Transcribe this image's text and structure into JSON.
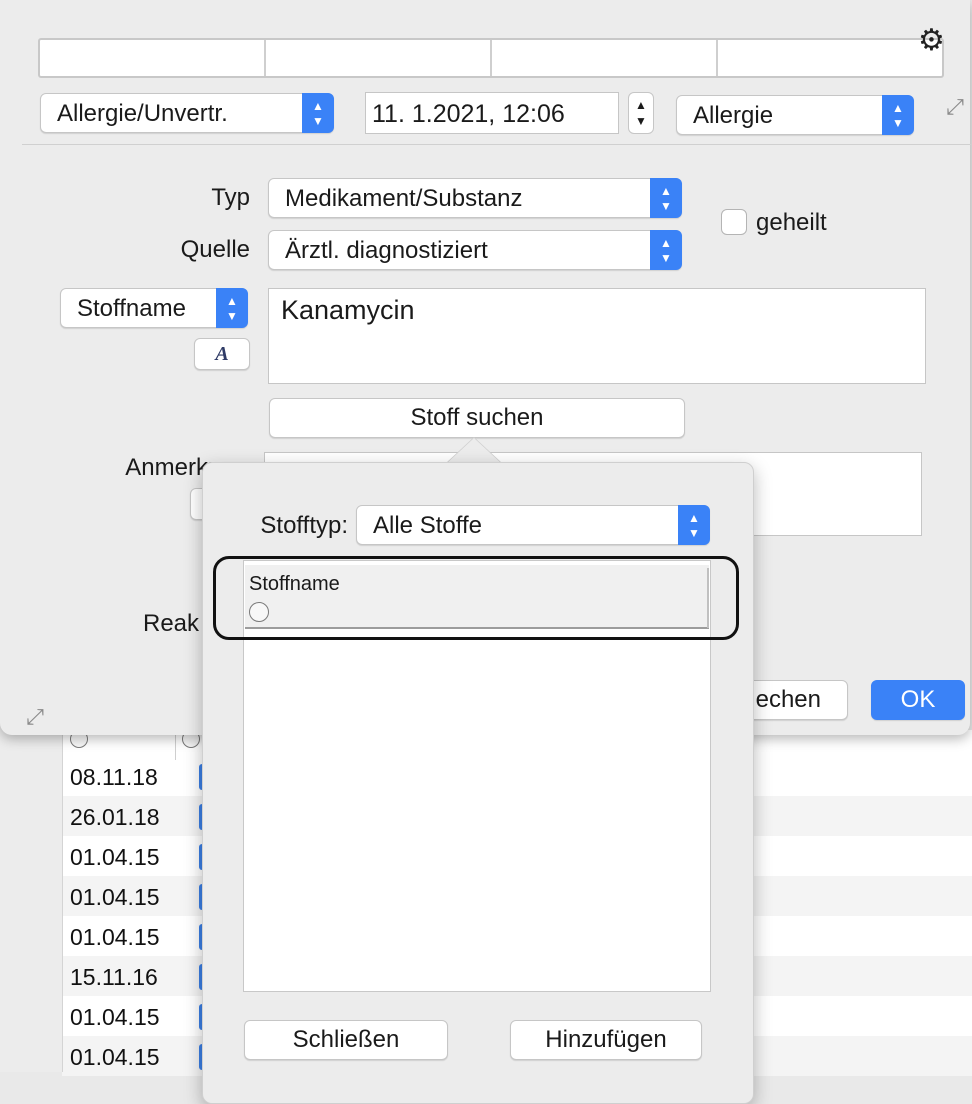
{
  "background_list": {
    "dates": [
      "08.11.18",
      "26.01.18",
      "01.04.15",
      "01.04.15",
      "01.04.15",
      "15.11.16",
      "01.04.15",
      "01.04.15"
    ]
  },
  "header": {
    "category_popup": "Allergie/Unvertr.",
    "datetime": "11.  1.2021, 12:06",
    "kind_popup": "Allergie"
  },
  "form": {
    "typ_label": "Typ",
    "typ_value": "Medikament/Substanz",
    "quelle_label": "Quelle",
    "quelle_value": "Ärztl. diagnostiziert",
    "geheilt_label": "geheilt",
    "stoffname_popup": "Stoffname",
    "font_button": "A",
    "stoffname_value": "Kanamycin",
    "search_button": "Stoff suchen",
    "anmerkung_label": "Anmerkung",
    "reaktion_label": "Reak",
    "delete_button_partial": "echen",
    "ok_button": "OK"
  },
  "popover": {
    "stofftyp_label": "Stofftyp:",
    "stofftyp_value": "Alle Stoffe",
    "column_header": "Stoffname",
    "close_button": "Schließen",
    "add_button": "Hinzufügen"
  },
  "colors": {
    "accent": "#3a82f7",
    "ok_button": "#3a82f7",
    "highlight_outline": "#111111"
  },
  "icons": {
    "gear": "gear-icon",
    "resize": "resize-arrows-icon",
    "popup_arrows": "chevron-updown-icon"
  }
}
